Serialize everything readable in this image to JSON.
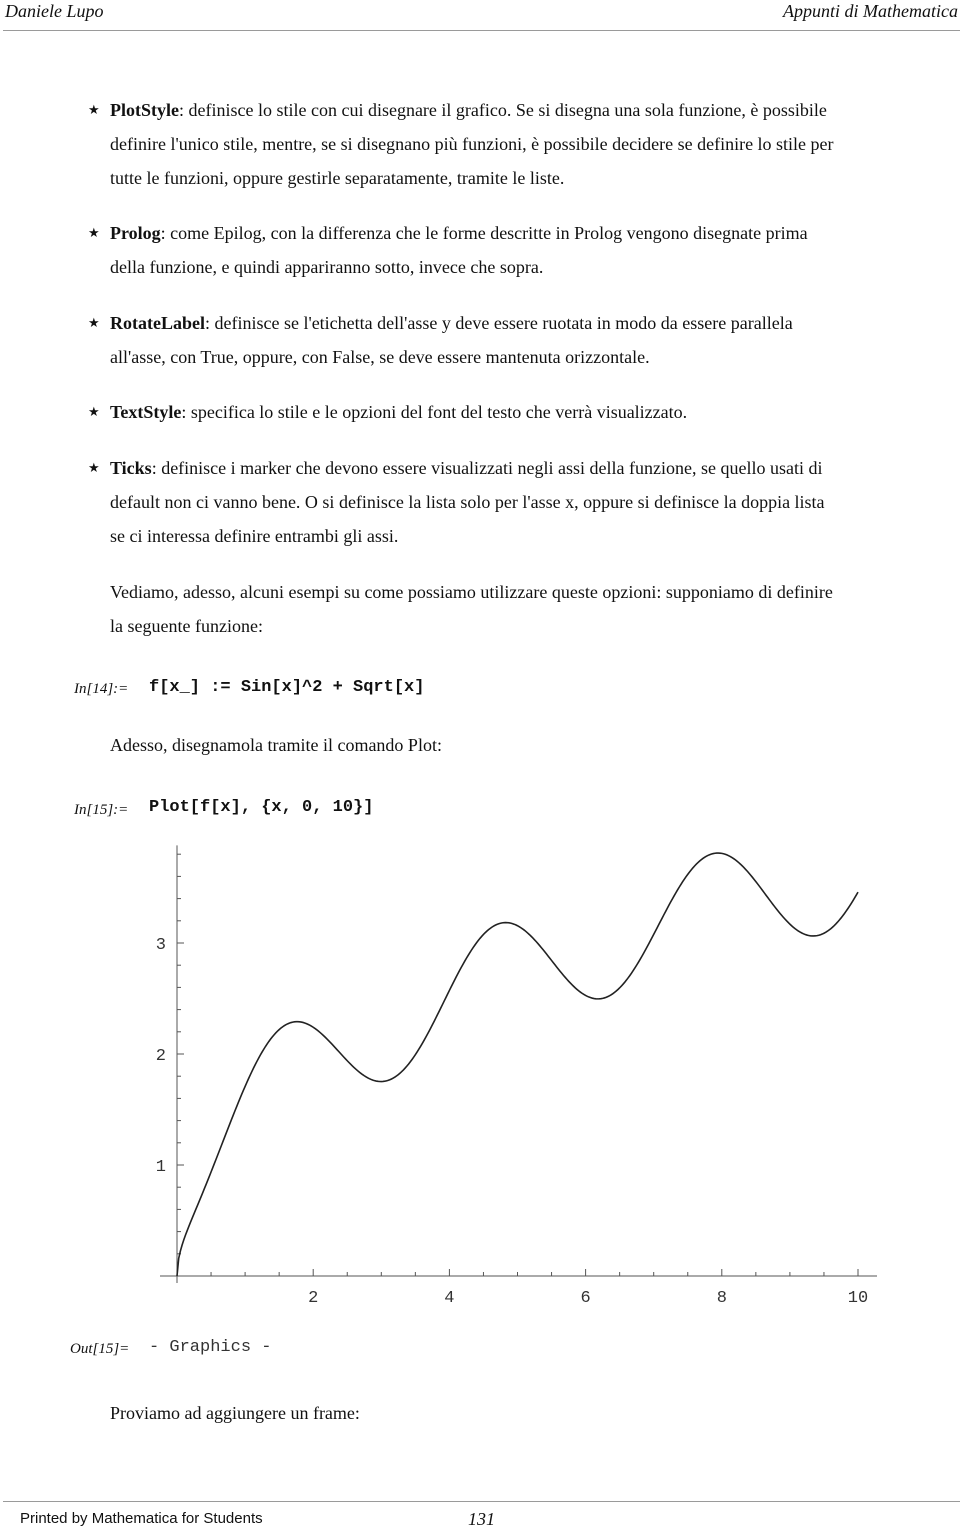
{
  "header": {
    "author": "Daniele Lupo",
    "title": "Appunti di Mathematica"
  },
  "bullets": [
    {
      "icon": "star-bullet-icon",
      "glyph": "★",
      "term": "PlotStyle",
      "lines": [
        ": definisce lo stile con cui disegnare il grafico. Se si disegna una sola funzione, è possibile",
        "definire l'unico stile, mentre, se si disegnano più funzioni, è possibile decidere se definire lo stile per",
        "tutte le funzioni, oppure gestirle separatamente, tramite le liste."
      ]
    },
    {
      "icon": "star-bullet-icon",
      "glyph": "★",
      "term": "Prolog",
      "lines": [
        ": come Epilog, con la differenza che le forme descritte in Prolog vengono disegnate prima",
        "della funzione, e quindi appariranno sotto, invece che sopra."
      ]
    },
    {
      "icon": "star-bullet-icon",
      "glyph": "★",
      "term": "RotateLabel",
      "lines": [
        ": definisce se l'etichetta dell'asse y deve essere ruotata in modo da essere parallela",
        "all'asse, con True, oppure, con False, se deve essere mantenuta orizzontale."
      ]
    },
    {
      "icon": "star-bullet-icon",
      "glyph": "★",
      "term": "TextStyle",
      "lines": [
        ": specifica lo stile e le opzioni del font del testo che verrà visualizzato."
      ]
    },
    {
      "icon": "star-bullet-icon",
      "glyph": "★",
      "term": "Ticks",
      "lines": [
        ": definisce i marker che devono essere visualizzati negli assi della funzione, se quello usati di",
        "default non ci vanno bene. O si definisce la lista solo per l'asse x, oppure si definisce la doppia lista",
        "se ci interessa definire entrambi gli assi."
      ]
    }
  ],
  "intro": {
    "lines": [
      "Vediamo, adesso, alcuni esempi su come possiamo utilizzare queste opzioni: supponiamo di definire",
      "la seguente funzione:"
    ]
  },
  "cells": {
    "in14": {
      "label": "In[14]:=",
      "code": "f[x_] := Sin[x]^2 + Sqrt[x]"
    },
    "text_plot": "Adesso, disegnamola tramite il comando Plot:",
    "in15": {
      "label": "In[15]:=",
      "code": "Plot[f[x], {x, 0, 10}]"
    },
    "out15": {
      "label": "Out[15]=",
      "value": "- Graphics -"
    },
    "text_frame": "Proviamo ad aggiungere un frame:"
  },
  "chart_data": {
    "type": "line",
    "title": "",
    "function": "Sin[x]^2 + Sqrt[x]",
    "xlabel": "",
    "ylabel": "",
    "xlim": [
      0,
      10
    ],
    "ylim": [
      0,
      3.88
    ],
    "x_ticks": [
      2,
      4,
      6,
      8,
      10
    ],
    "x_tick_labels": [
      "2",
      "4",
      "6",
      "8",
      "10"
    ],
    "x_minor_step": 0.5,
    "y_ticks": [
      1,
      2,
      3
    ],
    "y_tick_labels": [
      "1",
      "2",
      "3"
    ],
    "y_minor_step": 0.2,
    "grid": false,
    "legend": "none",
    "series": [
      {
        "name": "f[x]",
        "x": [
          0,
          0.5,
          1,
          1.5,
          2,
          2.5,
          3,
          3.5,
          4,
          4.5,
          5,
          5.5,
          6,
          6.5,
          7,
          7.5,
          8,
          8.5,
          9,
          9.5,
          10
        ],
        "y": [
          0,
          0.937,
          1.708,
          2.219,
          2.241,
          1.939,
          1.752,
          2.02,
          2.573,
          3.077,
          3.156,
          2.845,
          2.527,
          2.599,
          3.077,
          3.619,
          3.807,
          3.518,
          3.17,
          3.076,
          3.458
        ]
      }
    ]
  },
  "footer": {
    "printed_by": "Printed by Mathematica for Students",
    "page_number": "131"
  }
}
